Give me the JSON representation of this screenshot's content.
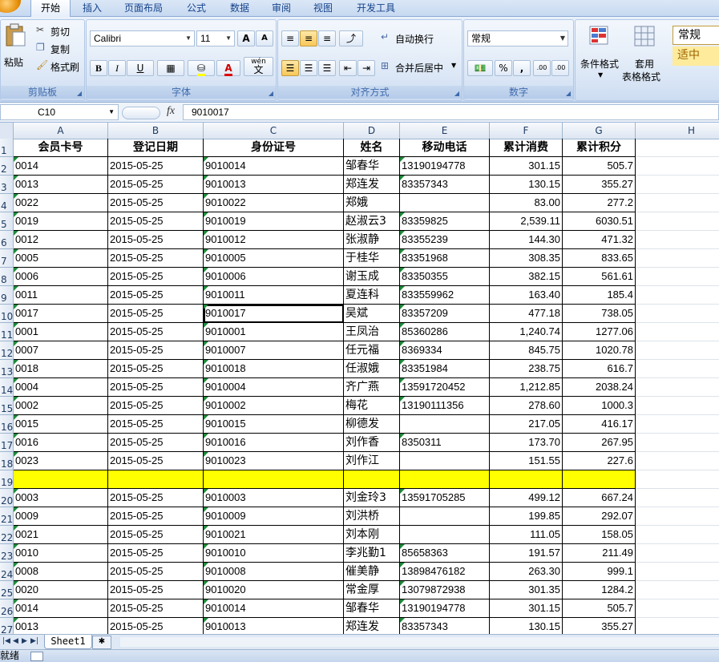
{
  "ribbon": {
    "tabs": [
      {
        "label": "开始",
        "active": true
      },
      {
        "label": "插入"
      },
      {
        "label": "页面布局"
      },
      {
        "label": "公式"
      },
      {
        "label": "数据"
      },
      {
        "label": "审阅"
      },
      {
        "label": "视图"
      },
      {
        "label": "开发工具"
      }
    ],
    "clipboard": {
      "paste": "粘贴",
      "cut": "剪切",
      "copy": "复制",
      "format_painter": "格式刷",
      "label": "剪贴板"
    },
    "font": {
      "name": "Calibri",
      "size": "11",
      "bold": "B",
      "italic": "I",
      "underline": "U",
      "grow": "A",
      "shrink": "A",
      "phonetic": "wén",
      "phonetic_sub": "文",
      "color_letter": "A",
      "label": "字体"
    },
    "alignment": {
      "wrap_text": "自动换行",
      "merge_center": "合并后居中",
      "label": "对齐方式"
    },
    "number": {
      "format": "常规",
      "percent": "%",
      "comma": ",",
      "inc_decimal": ".00",
      "dec_decimal": ".00",
      "label": "数字"
    },
    "styles": {
      "conditional": "条件格式",
      "table_line1": "套用",
      "table_line2": "表格格式",
      "style_normal": "常规",
      "style_neutral": "适中"
    }
  },
  "formula_bar": {
    "cell_ref": "C10",
    "fx": "fx",
    "value": "9010017"
  },
  "sheet": {
    "columns": [
      "A",
      "B",
      "C",
      "D",
      "E",
      "F",
      "G",
      "H"
    ],
    "headers": [
      "会员卡号",
      "登记日期",
      "身份证号",
      "姓名",
      "移动电话",
      "累计消费",
      "累计积分"
    ],
    "rows": [
      {
        "n": "2",
        "a": "0014",
        "b": "2015-05-25",
        "c": "9010014",
        "d": "邹春华",
        "e": "13190194778",
        "f": "301.15",
        "g": "505.7"
      },
      {
        "n": "3",
        "a": "0013",
        "b": "2015-05-25",
        "c": "9010013",
        "d": "郑连发",
        "e": "83357343",
        "f": "130.15",
        "g": "355.27"
      },
      {
        "n": "4",
        "a": "0022",
        "b": "2015-05-25",
        "c": "9010022",
        "d": "郑娥",
        "e": "",
        "f": "83.00",
        "g": "277.2"
      },
      {
        "n": "5",
        "a": "0019",
        "b": "2015-05-25",
        "c": "9010019",
        "d": "赵淑云3",
        "e": "83359825",
        "f": "2,539.11",
        "g": "6030.51"
      },
      {
        "n": "6",
        "a": "0012",
        "b": "2015-05-25",
        "c": "9010012",
        "d": "张淑静",
        "e": "83355239",
        "f": "144.30",
        "g": "471.32"
      },
      {
        "n": "7",
        "a": "0005",
        "b": "2015-05-25",
        "c": "9010005",
        "d": "于桂华",
        "e": "83351968",
        "f": "308.35",
        "g": "833.65"
      },
      {
        "n": "8",
        "a": "0006",
        "b": "2015-05-25",
        "c": "9010006",
        "d": "谢玉成",
        "e": "83350355",
        "f": "382.15",
        "g": "561.61"
      },
      {
        "n": "9",
        "a": "0011",
        "b": "2015-05-25",
        "c": "9010011",
        "d": "夏连科",
        "e": "833559962",
        "f": "163.40",
        "g": "185.4"
      },
      {
        "n": "10",
        "a": "0017",
        "b": "2015-05-25",
        "c": "9010017",
        "d": "吴斌",
        "e": "83357209",
        "f": "477.18",
        "g": "738.05"
      },
      {
        "n": "11",
        "a": "0001",
        "b": "2015-05-25",
        "c": "9010001",
        "d": "王凤治",
        "e": "85360286",
        "f": "1,240.74",
        "g": "1277.06"
      },
      {
        "n": "12",
        "a": "0007",
        "b": "2015-05-25",
        "c": "9010007",
        "d": "任元福",
        "e": "8369334",
        "f": "845.75",
        "g": "1020.78"
      },
      {
        "n": "13",
        "a": "0018",
        "b": "2015-05-25",
        "c": "9010018",
        "d": "任淑娥",
        "e": "83351984",
        "f": "238.75",
        "g": "616.7"
      },
      {
        "n": "14",
        "a": "0004",
        "b": "2015-05-25",
        "c": "9010004",
        "d": "齐广燕",
        "e": "13591720452",
        "f": "1,212.85",
        "g": "2038.24"
      },
      {
        "n": "15",
        "a": "0002",
        "b": "2015-05-25",
        "c": "9010002",
        "d": "梅花",
        "e": "13190111356",
        "f": "278.60",
        "g": "1000.3"
      },
      {
        "n": "16",
        "a": "0015",
        "b": "2015-05-25",
        "c": "9010015",
        "d": "柳德发",
        "e": "",
        "f": "217.05",
        "g": "416.17"
      },
      {
        "n": "17",
        "a": "0016",
        "b": "2015-05-25",
        "c": "9010016",
        "d": "刘作香",
        "e": "8350311",
        "f": "173.70",
        "g": "267.95"
      },
      {
        "n": "18",
        "a": "0023",
        "b": "2015-05-25",
        "c": "9010023",
        "d": "刘作江",
        "e": "",
        "f": "151.55",
        "g": "227.6"
      },
      {
        "n": "19",
        "a": "",
        "b": "",
        "c": "",
        "d": "",
        "e": "",
        "f": "",
        "g": "",
        "highlight": true
      },
      {
        "n": "20",
        "a": "0003",
        "b": "2015-05-25",
        "c": "9010003",
        "d": "刘金玲3",
        "e": "13591705285",
        "f": "499.12",
        "g": "667.24"
      },
      {
        "n": "21",
        "a": "0009",
        "b": "2015-05-25",
        "c": "9010009",
        "d": "刘洪桥",
        "e": "",
        "f": "199.85",
        "g": "292.07"
      },
      {
        "n": "22",
        "a": "0021",
        "b": "2015-05-25",
        "c": "9010021",
        "d": "刘本刚",
        "e": "",
        "f": "111.05",
        "g": "158.05"
      },
      {
        "n": "23",
        "a": "0010",
        "b": "2015-05-25",
        "c": "9010010",
        "d": "李兆勤1",
        "e": "85658363",
        "f": "191.57",
        "g": "211.49"
      },
      {
        "n": "24",
        "a": "0008",
        "b": "2015-05-25",
        "c": "9010008",
        "d": "催美静",
        "e": "13898476182",
        "f": "263.30",
        "g": "999.1"
      },
      {
        "n": "25",
        "a": "0020",
        "b": "2015-05-25",
        "c": "9010020",
        "d": "常金厚",
        "e": "13079872938",
        "f": "301.35",
        "g": "1284.2"
      },
      {
        "n": "26",
        "a": "0014",
        "b": "2015-05-25",
        "c": "9010014",
        "d": "邹春华",
        "e": "13190194778",
        "f": "301.15",
        "g": "505.7"
      },
      {
        "n": "27",
        "a": "0013",
        "b": "2015-05-25",
        "c": "9010013",
        "d": "郑连发",
        "e": "83357343",
        "f": "130.15",
        "g": "355.27"
      }
    ],
    "highlight_color": "#ffff00"
  },
  "sheet_tabs": {
    "active": "Sheet1"
  },
  "status": {
    "text": "就绪"
  }
}
